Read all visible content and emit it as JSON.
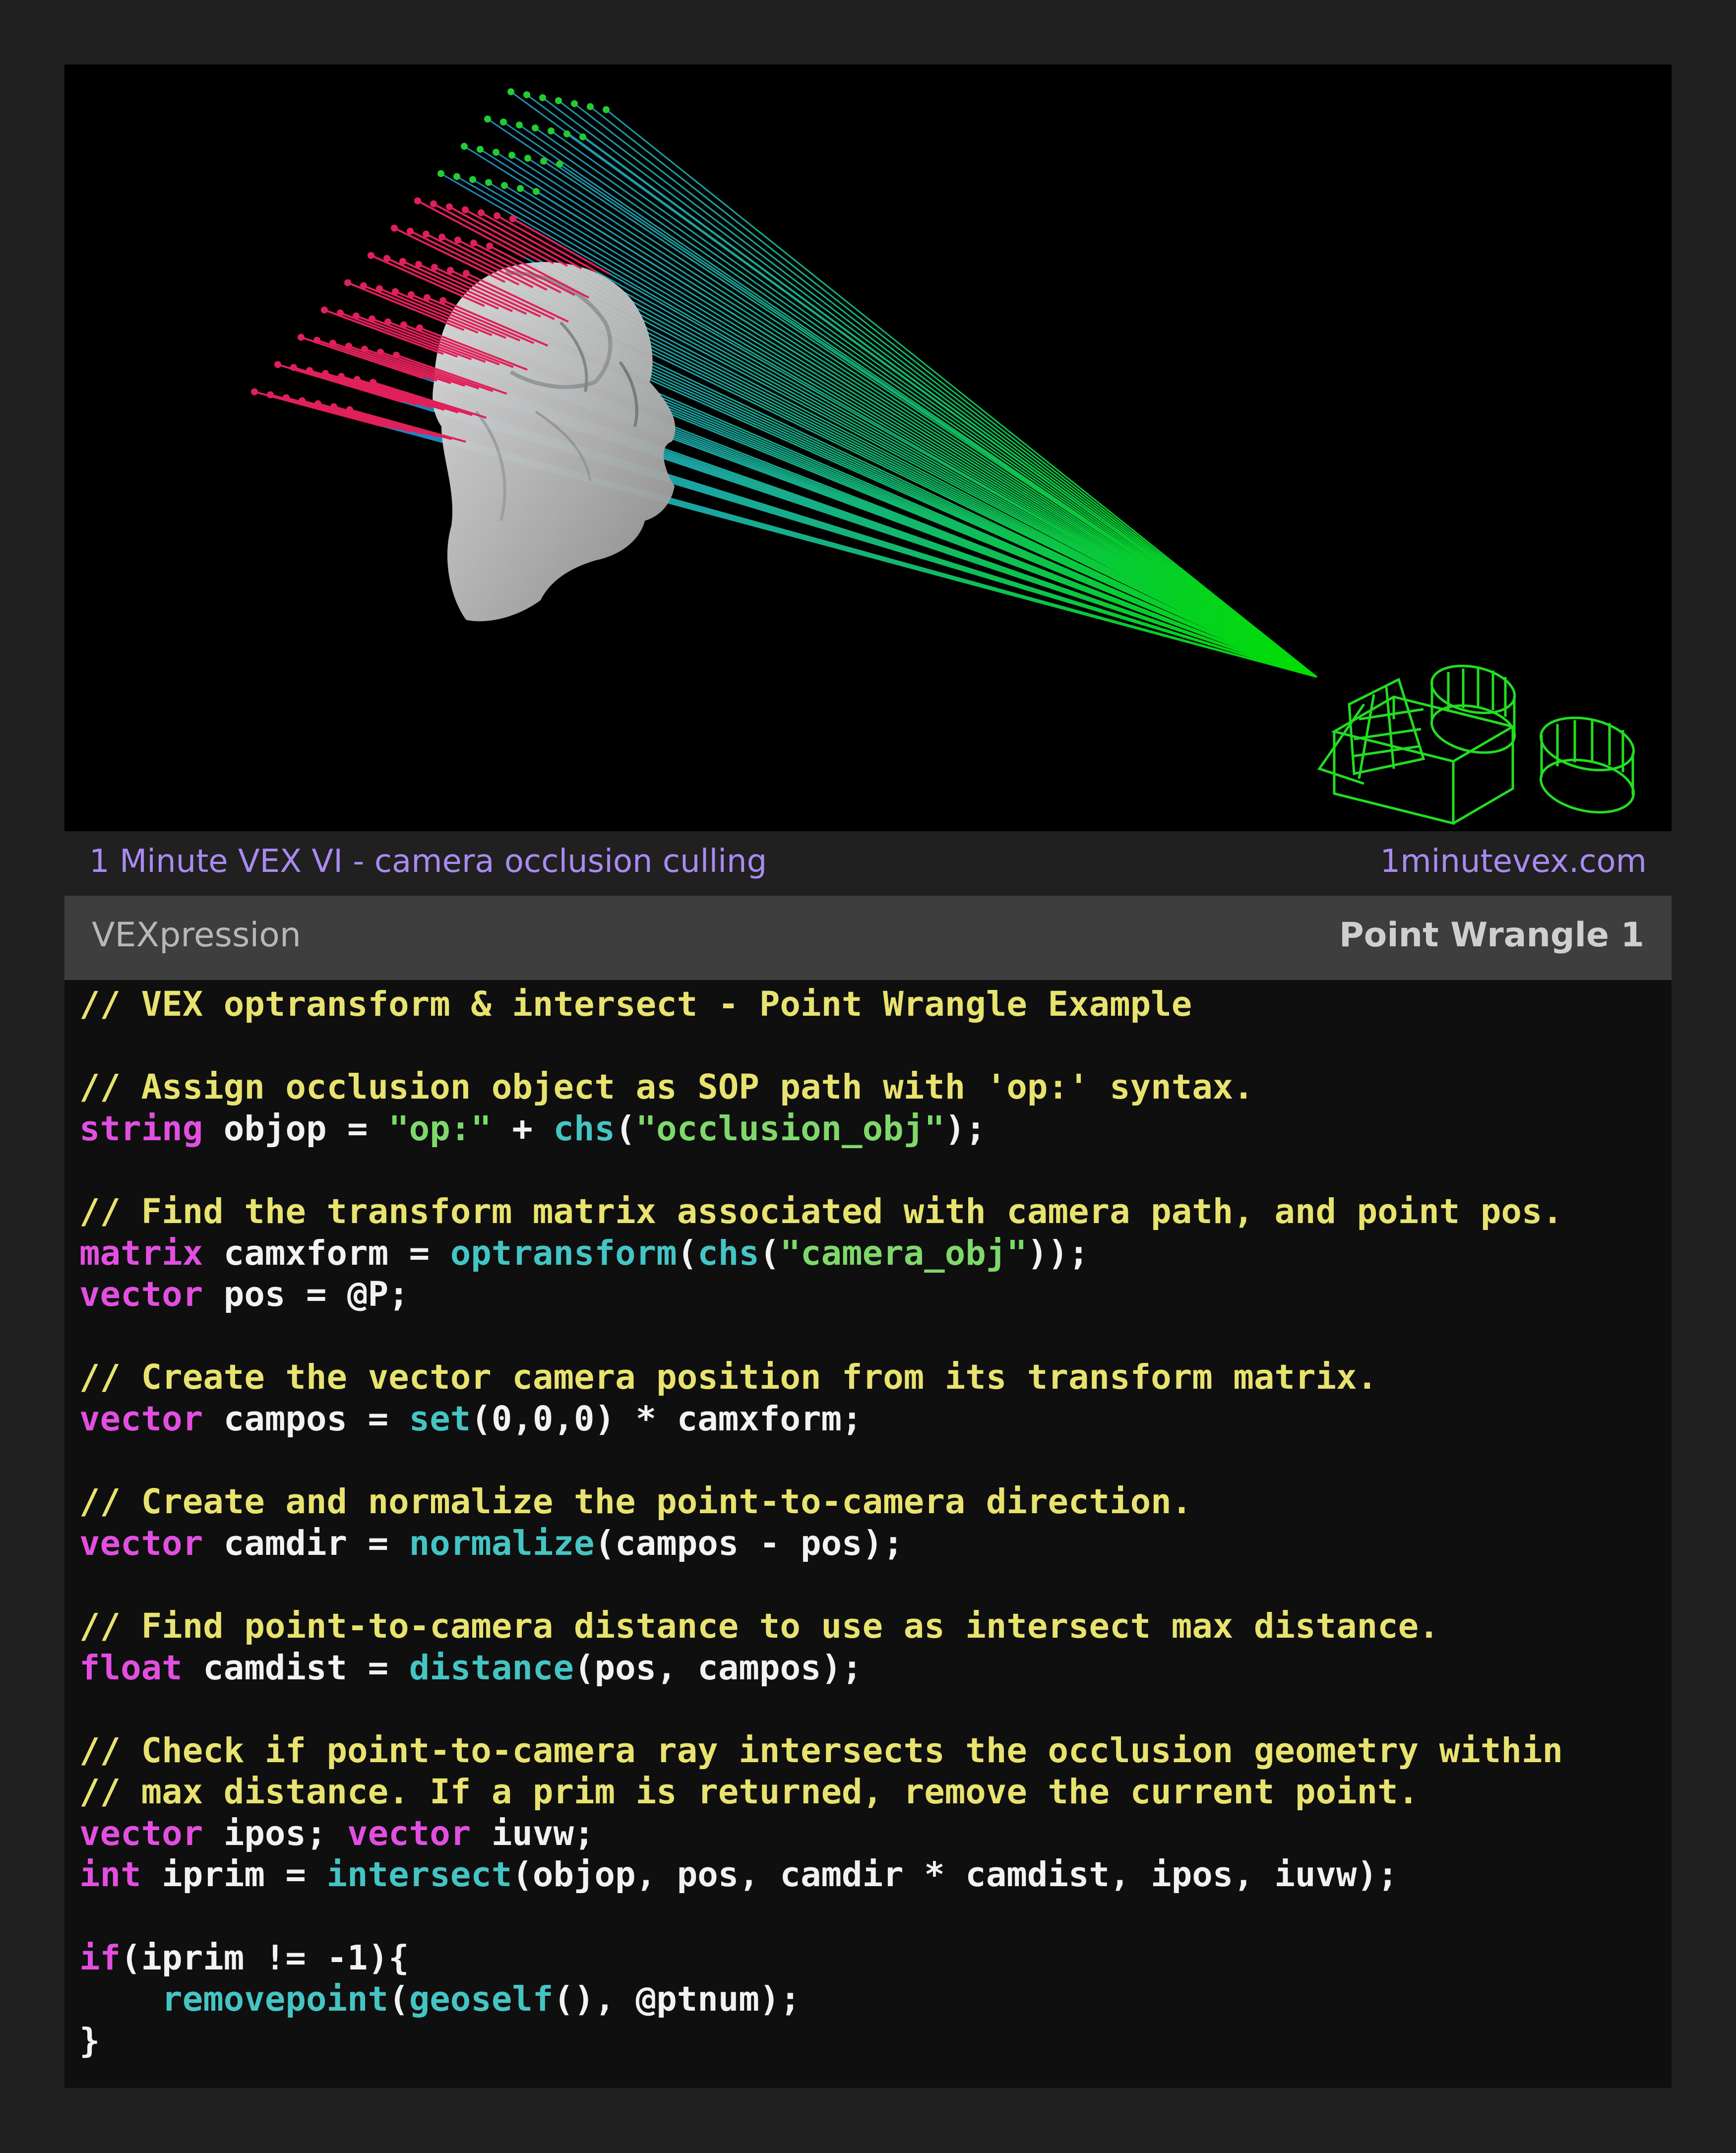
{
  "caption": {
    "title": "1 Minute VEX VI - camera occlusion culling",
    "site": "1minutevex.com"
  },
  "editor": {
    "title": "VEXpression",
    "node_name": "Point Wrangle 1"
  },
  "colors": {
    "page_background": "#202020",
    "viewport_background": "#000000",
    "caption_text": "#a98af0",
    "header_background": "#3e3e3e",
    "code_background": "#0f0f0f",
    "comment": "#e8e26f",
    "keyword": "#e24fe0",
    "function": "#45c4c4",
    "string": "#7fd86b",
    "plain": "#f2f2f2",
    "camera_wireframe": "#22dd22",
    "ray_near_camera": "#00dd00",
    "ray_far_blue": "#2a6bd0",
    "ray_occluded": "#e0205a",
    "point_kept": "#22cc33",
    "occluder_mesh": "#c8c8c8"
  },
  "viewport": {
    "scene_elements": [
      "camera-wireframe-icon",
      "occlusion-bust-mesh",
      "camera-rays",
      "grid-points"
    ]
  },
  "code_lines": [
    [
      [
        "c",
        "// VEX optransform & intersect - Point Wrangle Example"
      ]
    ],
    [],
    [
      [
        "c",
        "// Assign occlusion object as SOP path with 'op:' syntax."
      ]
    ],
    [
      [
        "k",
        "string"
      ],
      [
        "p",
        " objop = "
      ],
      [
        "s",
        "\"op:\""
      ],
      [
        "p",
        " + "
      ],
      [
        "f",
        "chs"
      ],
      [
        "p",
        "("
      ],
      [
        "s",
        "\"occlusion_obj\""
      ],
      [
        "p",
        ");"
      ]
    ],
    [],
    [
      [
        "c",
        "// Find the transform matrix associated with camera path, and point pos."
      ]
    ],
    [
      [
        "k",
        "matrix"
      ],
      [
        "p",
        " camxform = "
      ],
      [
        "f",
        "optransform"
      ],
      [
        "p",
        "("
      ],
      [
        "f",
        "chs"
      ],
      [
        "p",
        "("
      ],
      [
        "s",
        "\"camera_obj\""
      ],
      [
        "p",
        "));"
      ]
    ],
    [
      [
        "k",
        "vector"
      ],
      [
        "p",
        " pos = @P;"
      ]
    ],
    [],
    [
      [
        "c",
        "// Create the vector camera position from its transform matrix."
      ]
    ],
    [
      [
        "k",
        "vector"
      ],
      [
        "p",
        " campos = "
      ],
      [
        "f",
        "set"
      ],
      [
        "p",
        "(0,0,0) * camxform;"
      ]
    ],
    [],
    [
      [
        "c",
        "// Create and normalize the point-to-camera direction."
      ]
    ],
    [
      [
        "k",
        "vector"
      ],
      [
        "p",
        " camdir = "
      ],
      [
        "f",
        "normalize"
      ],
      [
        "p",
        "(campos - pos);"
      ]
    ],
    [],
    [
      [
        "c",
        "// Find point-to-camera distance to use as intersect max distance."
      ]
    ],
    [
      [
        "k",
        "float"
      ],
      [
        "p",
        " camdist = "
      ],
      [
        "f",
        "distance"
      ],
      [
        "p",
        "(pos, campos);"
      ]
    ],
    [],
    [
      [
        "c",
        "// Check if point-to-camera ray intersects the occlusion geometry within"
      ]
    ],
    [
      [
        "c",
        "// max distance. If a prim is returned, remove the current point."
      ]
    ],
    [
      [
        "k",
        "vector"
      ],
      [
        "p",
        " ipos; "
      ],
      [
        "k",
        "vector"
      ],
      [
        "p",
        " iuvw;"
      ]
    ],
    [
      [
        "k",
        "int"
      ],
      [
        "p",
        " iprim = "
      ],
      [
        "f",
        "intersect"
      ],
      [
        "p",
        "(objop, pos, camdir * camdist, ipos, iuvw);"
      ]
    ],
    [],
    [
      [
        "k",
        "if"
      ],
      [
        "p",
        "(iprim != -1){"
      ]
    ],
    [
      [
        "p",
        "    "
      ],
      [
        "f",
        "removepoint"
      ],
      [
        "p",
        "("
      ],
      [
        "f",
        "geoself"
      ],
      [
        "p",
        "(), @ptnum);"
      ]
    ],
    [
      [
        "p",
        "}"
      ]
    ]
  ]
}
